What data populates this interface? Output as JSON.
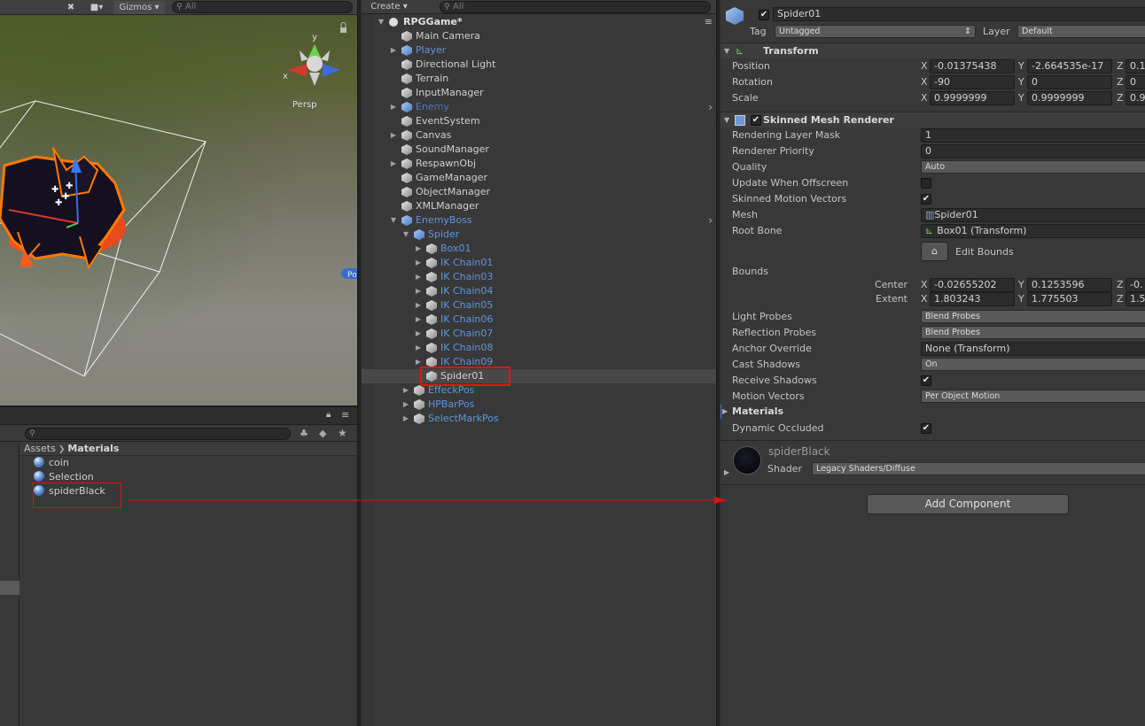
{
  "scene": {
    "toolbar": {
      "gizmos_label": "Gizmos",
      "search_placeholder": "All"
    },
    "gizmo": {
      "y_label": "y",
      "x_label": "x",
      "persp_label": "Persp"
    },
    "object_badge": "Po"
  },
  "project": {
    "search_placeholder": "",
    "breadcrumb": {
      "root": "Assets",
      "current": "Materials"
    },
    "assets": [
      "coin",
      "Selection",
      "spiderBlack"
    ]
  },
  "hierarchy": {
    "toolbar": {
      "create_label": "Create",
      "search_placeholder": "All"
    },
    "scene_name": "RPGGame*",
    "rows": [
      {
        "label": "Main Camera",
        "style": "plain"
      },
      {
        "label": "Player",
        "style": "prefab"
      },
      {
        "label": "Directional Light",
        "style": "plain"
      },
      {
        "label": "Terrain",
        "style": "plain"
      },
      {
        "label": "InputManager",
        "style": "plain"
      },
      {
        "label": "Enemy",
        "style": "prefab-dim"
      },
      {
        "label": "EventSystem",
        "style": "plain"
      },
      {
        "label": "Canvas",
        "style": "plain"
      },
      {
        "label": "SoundManager",
        "style": "plain"
      },
      {
        "label": "RespawnObj",
        "style": "plain"
      },
      {
        "label": "GameManager",
        "style": "plain"
      },
      {
        "label": "ObjectManager",
        "style": "plain"
      },
      {
        "label": "XMLManager",
        "style": "plain"
      },
      {
        "label": "EnemyBoss",
        "style": "prefab"
      },
      {
        "label": "Spider",
        "style": "prefab"
      },
      {
        "label": "Box01",
        "style": "prefab"
      },
      {
        "label": "IK Chain01",
        "style": "prefab"
      },
      {
        "label": "IK Chain03",
        "style": "prefab"
      },
      {
        "label": "IK Chain04",
        "style": "prefab"
      },
      {
        "label": "IK Chain05",
        "style": "prefab"
      },
      {
        "label": "IK Chain06",
        "style": "prefab"
      },
      {
        "label": "IK Chain07",
        "style": "prefab"
      },
      {
        "label": "IK Chain08",
        "style": "prefab"
      },
      {
        "label": "IK Chain09",
        "style": "prefab"
      },
      {
        "label": "Spider01",
        "style": "plain"
      },
      {
        "label": "EffeckPos",
        "style": "prefab"
      },
      {
        "label": "HPBarPos",
        "style": "prefab"
      },
      {
        "label": "SelectMarkPos",
        "style": "prefab"
      }
    ]
  },
  "inspector": {
    "object_name": "Spider01",
    "active": true,
    "tag_label": "Tag",
    "tag_value": "Untagged",
    "layer_label": "Layer",
    "layer_value": "Default",
    "transform": {
      "title": "Transform",
      "position_label": "Position",
      "rotation_label": "Rotation",
      "scale_label": "Scale",
      "axis_x": "X",
      "axis_y": "Y",
      "axis_z": "Z",
      "position": {
        "x": "-0.01375438",
        "y": "-2.664535e-17",
        "z": "0.1"
      },
      "rotation": {
        "x": "-90",
        "y": "0",
        "z": "0"
      },
      "scale": {
        "x": "0.9999999",
        "y": "0.9999999",
        "z": "0.9"
      }
    },
    "renderer": {
      "title": "Skinned Mesh Renderer",
      "enabled": true,
      "rendering_layer_mask_label": "Rendering Layer Mask",
      "rendering_layer_mask": "1",
      "renderer_priority_label": "Renderer Priority",
      "renderer_priority": "0",
      "quality_label": "Quality",
      "quality": "Auto",
      "update_offscreen_label": "Update When Offscreen",
      "update_offscreen": false,
      "skinned_motion_label": "Skinned Motion Vectors",
      "skinned_motion": true,
      "mesh_label": "Mesh",
      "mesh": "Spider01",
      "root_bone_label": "Root Bone",
      "root_bone": "Box01 (Transform)",
      "edit_bounds_label": "Edit Bounds",
      "bounds_label": "Bounds",
      "center_label": "Center",
      "extent_label": "Extent",
      "center": {
        "x": "-0.02655202",
        "y": "0.1253596",
        "z": "-0."
      },
      "extent": {
        "x": "1.803243",
        "y": "1.775503",
        "z": "1.5"
      },
      "light_probes_label": "Light Probes",
      "light_probes": "Blend Probes",
      "reflection_probes_label": "Reflection Probes",
      "reflection_probes": "Blend Probes",
      "anchor_override_label": "Anchor Override",
      "anchor_override": "None (Transform)",
      "cast_shadows_label": "Cast Shadows",
      "cast_shadows": "On",
      "receive_shadows_label": "Receive Shadows",
      "receive_shadows": true,
      "motion_vectors_label": "Motion Vectors",
      "motion_vectors": "Per Object Motion",
      "materials_label": "Materials",
      "dynamic_occluded_label": "Dynamic Occluded",
      "dynamic_occluded": true
    },
    "material": {
      "name": "spiderBlack",
      "shader_label": "Shader",
      "shader": "Legacy Shaders/Diffuse"
    },
    "add_component_label": "Add Component"
  },
  "colors": {
    "highlight_red": "#e01010",
    "prefab_blue": "#5f95dd",
    "background": "#383838"
  }
}
